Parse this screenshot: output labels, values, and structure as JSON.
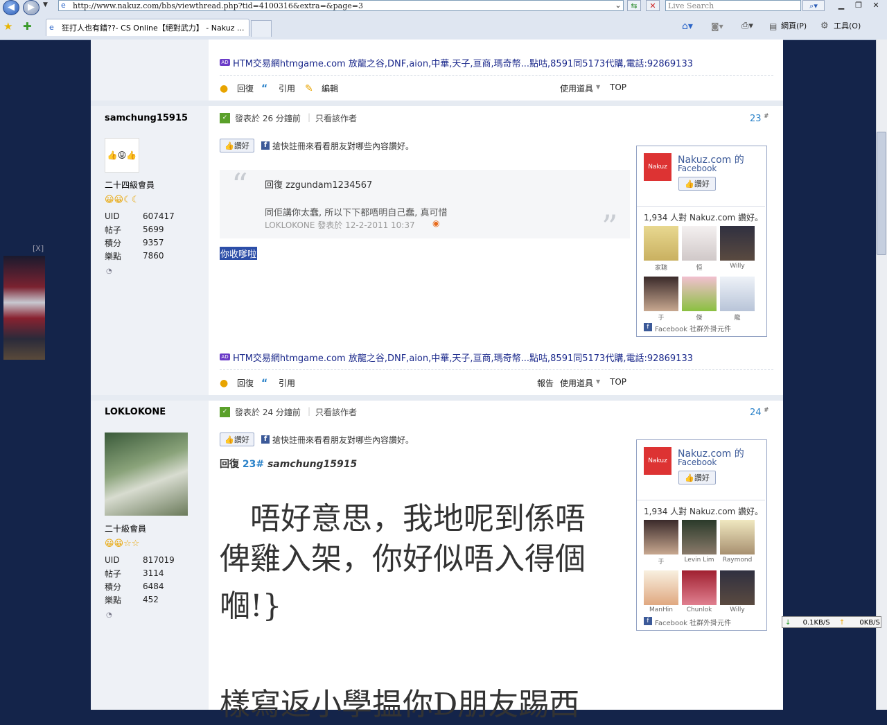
{
  "browser": {
    "url": "http://www.nakuz.com/bbs/viewthread.php?tid=4100316&extra=&page=3",
    "search_placeholder": "Live Search",
    "tab_title": "狂打人也有錯??- CS Online【絕對武力】 - Nakuz ...",
    "cmd_page": "網頁(P)",
    "cmd_tools": "工具(O)"
  },
  "ad_text": "HTM交易網htmgame.com 放龍之谷,DNF,aion,中華,天子,亘商,瑪奇幣...點咕,8591同5173代購,電話:92869133",
  "ad_badge": "AD",
  "actions": {
    "reply": "回復",
    "quote": "引用",
    "edit": "編輯",
    "tools": "使用道具",
    "top": "TOP",
    "report": "報告"
  },
  "post23": {
    "author": "samchung15915",
    "rank": "二十四級會員",
    "stats": [
      {
        "k": "UID",
        "v": "607417"
      },
      {
        "k": "帖子",
        "v": "5699"
      },
      {
        "k": "積分",
        "v": "9357"
      },
      {
        "k": "樂點",
        "v": "7860"
      }
    ],
    "posted": "發表於 26 分鐘前",
    "only_author": "只看該作者",
    "number": "23",
    "like": "讚好",
    "fb_prompt": "搶快註冊來看看朋友對哪些內容讚好。",
    "quote_head": "回復  zzgundam1234567",
    "quote_body": "同佢講你太蠢, 所以下下都唔明自己蠢, 真可惜",
    "quote_meta": "LOKLOKONE 發表於 12-2-2011 10:37",
    "body": "你收嗲啦"
  },
  "post24": {
    "author": "LOKLOKONE",
    "rank": "二十級會員",
    "stats": [
      {
        "k": "UID",
        "v": "817019"
      },
      {
        "k": "帖子",
        "v": "3114"
      },
      {
        "k": "積分",
        "v": "6484"
      },
      {
        "k": "樂點",
        "v": "452"
      }
    ],
    "posted": "發表於 24 分鐘前",
    "only_author": "只看該作者",
    "number": "24",
    "like": "讚好",
    "fb_prompt": "搶快註冊來看看朋友對哪些內容讚好。",
    "reply_prefix": "回復",
    "reply_num": "23#",
    "reply_user": "samchung15915",
    "body_lines": [
      "　唔好意思，我地呢到係唔",
      "俾雞入架，你好似唔入得個",
      "嗰!}",
      "",
      "樣寫返小學揾你D朋友踢西"
    ]
  },
  "fb_widget": {
    "name": "Nakuz.com 的",
    "sub": "Facebook",
    "like": "讚好",
    "count": "1,934 人對 Nakuz.com 讚好。",
    "footer": "Facebook 社群外掛元件",
    "faces1": [
      "家聰",
      "恒",
      "Willy",
      "于",
      "傑",
      "龍"
    ],
    "faces2": [
      "于",
      "Levin Lim",
      "Raymond",
      "ManHin",
      "Chunlok",
      "Willy"
    ]
  },
  "net": {
    "down": "0.1KB/S",
    "up": "0KB/S"
  },
  "side_close": "[X]",
  "colors": {
    "page_bg": "#14244a",
    "link": "#1c3cb4",
    "post_num": "#2a82c9",
    "fb_blue": "#3b5998"
  }
}
